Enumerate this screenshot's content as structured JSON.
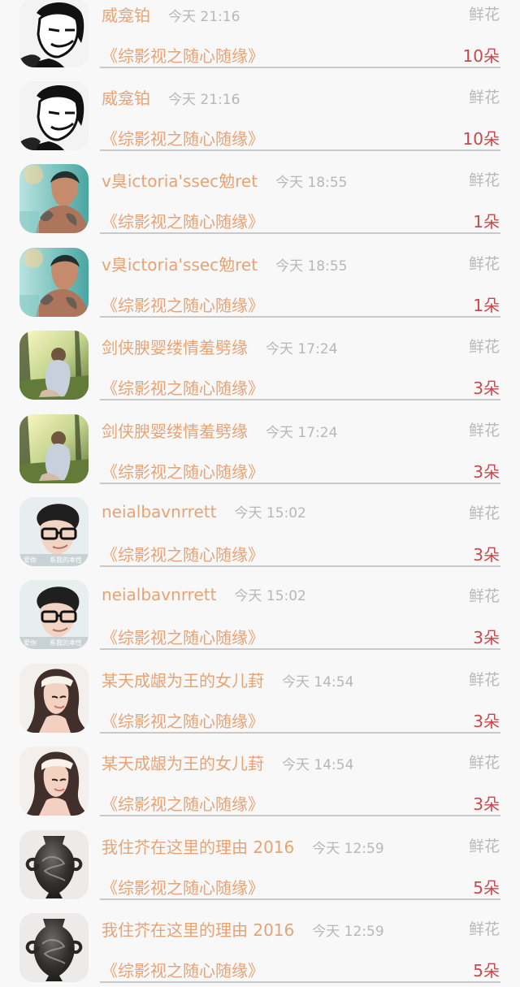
{
  "records": [
    {
      "user": "威龛铂",
      "time": "今天 21:16",
      "gift_type": "鲜花",
      "book": "《综影视之随心随缘》",
      "amount": "10朵",
      "avatar": "manga-boy"
    },
    {
      "user": "威龛铂",
      "time": "今天 21:16",
      "gift_type": "鲜花",
      "book": "《综影视之随心随缘》",
      "amount": "10朵",
      "avatar": "manga-boy"
    },
    {
      "user": "v臭ictoria'ssec勉ret",
      "time": "今天 18:55",
      "gift_type": "鲜花",
      "book": "《综影视之随心随缘》",
      "amount": "1朵",
      "avatar": "tattoo-man"
    },
    {
      "user": "v臭ictoria'ssec勉ret",
      "time": "今天 18:55",
      "gift_type": "鲜花",
      "book": "《综影视之随心随缘》",
      "amount": "1朵",
      "avatar": "tattoo-man"
    },
    {
      "user": "剑侠腴婴缕情羞劈缘",
      "time": "今天 17:24",
      "gift_type": "鲜花",
      "book": "《综影视之随心随缘》",
      "amount": "3朵",
      "avatar": "sunset-girl"
    },
    {
      "user": "剑侠腴婴缕情羞劈缘",
      "time": "今天 17:24",
      "gift_type": "鲜花",
      "book": "《综影视之随心随缘》",
      "amount": "3朵",
      "avatar": "sunset-girl"
    },
    {
      "user": "neialbavnrrett",
      "time": "今天 15:02",
      "gift_type": "鲜花",
      "book": "《综影视之随心随缘》",
      "amount": "3朵",
      "avatar": "glasses-boy"
    },
    {
      "user": "neialbavnrrett",
      "time": "今天 15:02",
      "gift_type": "鲜花",
      "book": "《综影视之随心随缘》",
      "amount": "3朵",
      "avatar": "glasses-boy"
    },
    {
      "user": "某天成龈为王的女儿葑",
      "time": "今天 14:54",
      "gift_type": "鲜花",
      "book": "《综影视之随心随缘》",
      "amount": "3朵",
      "avatar": "long-hair-girl"
    },
    {
      "user": "某天成龈为王的女儿葑",
      "time": "今天 14:54",
      "gift_type": "鲜花",
      "book": "《综影视之随心随缘》",
      "amount": "3朵",
      "avatar": "long-hair-girl"
    },
    {
      "user": "我住芥在这里的理由 2016",
      "time": "今天 12:59",
      "gift_type": "鲜花",
      "book": "《综影视之随心随缘》",
      "amount": "5朵",
      "avatar": "dragon-vase"
    },
    {
      "user": "我住芥在这里的理由 2016",
      "time": "今天 12:59",
      "gift_type": "鲜花",
      "book": "《综影视之随心随缘》",
      "amount": "5朵",
      "avatar": "dragon-vase"
    }
  ],
  "avatar_texts": {
    "glasses_left": "爱你",
    "glasses_right": "系我的本性"
  },
  "colors": {
    "name": "#e7a374",
    "time": "#b7b7b7",
    "gift_type": "#b9b9b9",
    "amount": "#c8484d",
    "divider": "#c9c9c9",
    "background": "#f8f8f8"
  }
}
